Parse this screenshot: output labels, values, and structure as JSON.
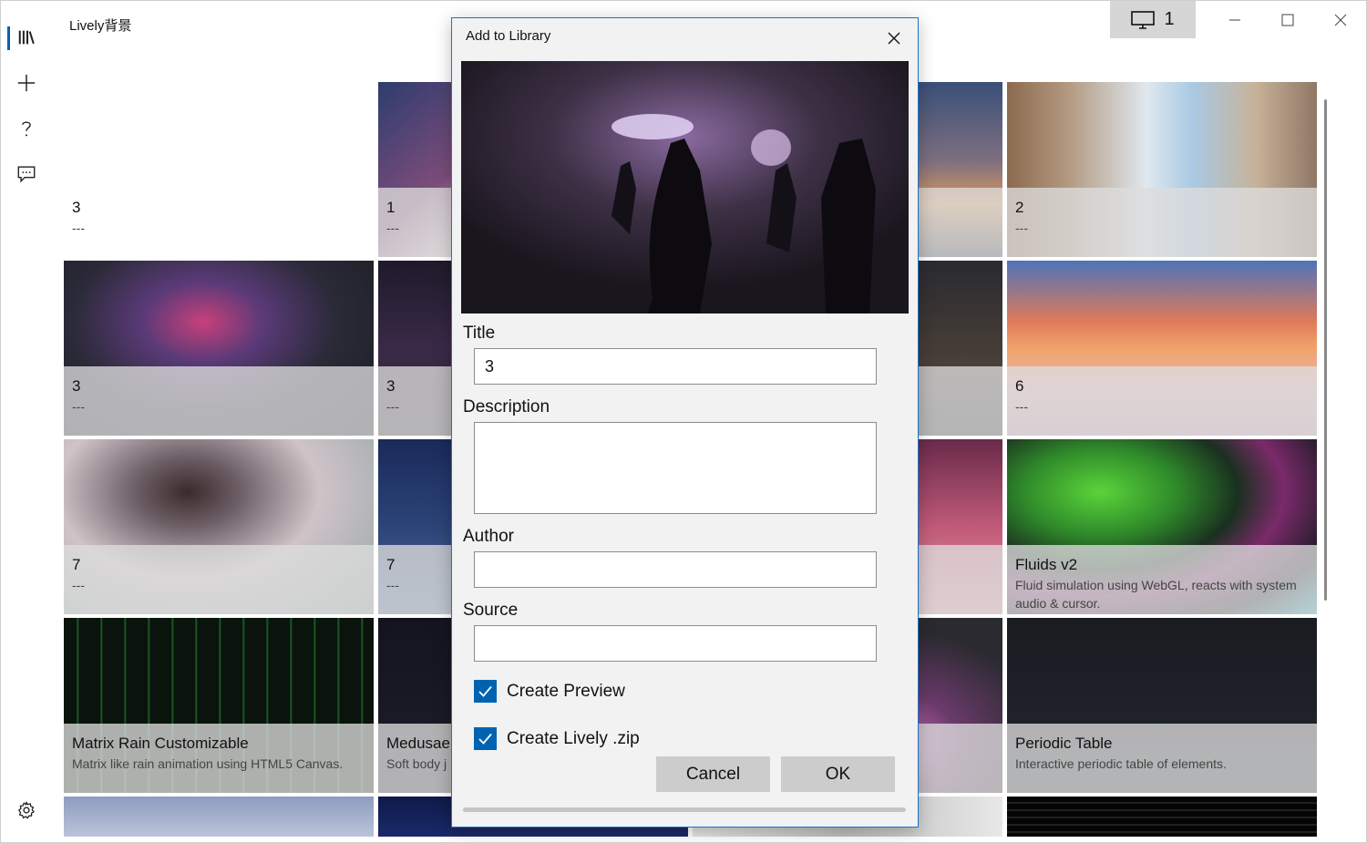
{
  "app": {
    "title": "Lively背景",
    "monitor_label": "1",
    "icons": {
      "library": "library-icon",
      "add": "plus-icon",
      "help": "question-icon",
      "feedback": "chat-bubble-icon",
      "settings": "gear-icon",
      "monitor": "monitor-icon",
      "minimize": "minimize-icon",
      "maximize": "maximize-icon",
      "close": "close-icon"
    }
  },
  "library": {
    "tiles": [
      {
        "title": "3",
        "desc": "---"
      },
      {
        "title": "1",
        "desc": "---"
      },
      {
        "title": "2",
        "desc": "---"
      },
      {
        "title": "3",
        "desc": "---"
      },
      {
        "title": "3",
        "desc": "---"
      },
      {
        "title": "6",
        "desc": "---"
      },
      {
        "title": "7",
        "desc": "---"
      },
      {
        "title": "7",
        "desc": "---"
      },
      {
        "title": "Fluids v2",
        "desc": "Fluid simulation using WebGL, reacts with system audio & cursor."
      },
      {
        "title": "Matrix Rain Customizable",
        "desc": "Matrix like rain animation using HTML5 Canvas."
      },
      {
        "title": "Medusae",
        "desc": "Soft body j"
      },
      {
        "title": "Periodic Table",
        "desc": "Interactive periodic table of elements."
      }
    ]
  },
  "dialog": {
    "title": "Add to Library",
    "title_label": "Title",
    "title_value": "3",
    "description_label": "Description",
    "description_value": "",
    "author_label": "Author",
    "author_value": "",
    "source_label": "Source",
    "source_value": "",
    "create_preview_label": "Create Preview",
    "create_preview_checked": true,
    "create_zip_label": "Create Lively .zip",
    "create_zip_checked": true,
    "cancel_label": "Cancel",
    "ok_label": "OK",
    "accent_color": "#0063b1"
  }
}
